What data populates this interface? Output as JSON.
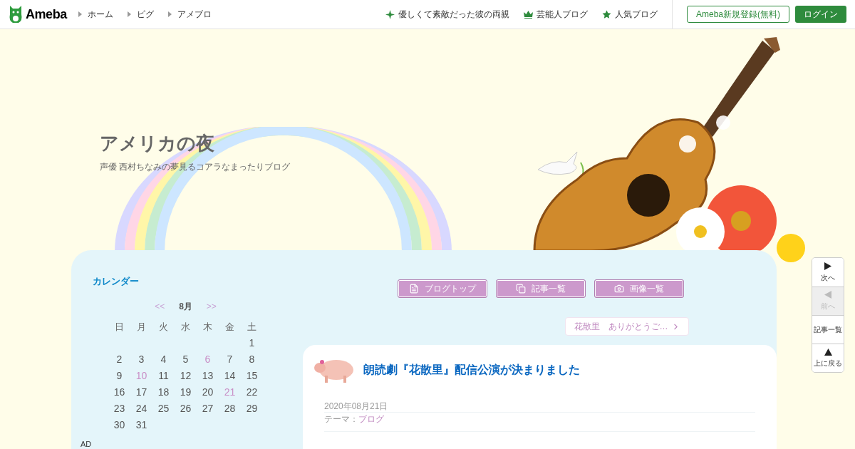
{
  "header": {
    "logo": "Ameba",
    "breadcrumbs": [
      "ホーム",
      "ピグ",
      "アメブロ"
    ],
    "links": [
      {
        "kind": "sparkle",
        "label": "優しくて素敵だった彼の両親"
      },
      {
        "kind": "crown",
        "label": "芸能人ブログ"
      },
      {
        "kind": "star",
        "label": "人気ブログ"
      }
    ],
    "register_button": "Ameba新規登録(無料)",
    "login_button": "ログイン"
  },
  "blog": {
    "title": "アメリカの夜",
    "description": "声優 西村ちなみの夢見るコアラなまったりブログ"
  },
  "calendar": {
    "heading": "カレンダー",
    "prev": "<<",
    "month": "8月",
    "next": ">>",
    "weekdays": [
      "日",
      "月",
      "火",
      "水",
      "木",
      "金",
      "土"
    ],
    "weeks": [
      [
        {
          "day": "1",
          "has_entry": false
        }
      ],
      [
        {
          "day": "2",
          "has_entry": false
        },
        {
          "day": "3",
          "has_entry": false
        },
        {
          "day": "4",
          "has_entry": false
        },
        {
          "day": "5",
          "has_entry": false
        },
        {
          "day": "6",
          "has_entry": true
        },
        {
          "day": "7",
          "has_entry": false
        },
        {
          "day": "8",
          "has_entry": false
        }
      ],
      [
        {
          "day": "9",
          "has_entry": false
        },
        {
          "day": "10",
          "has_entry": true
        },
        {
          "day": "11",
          "has_entry": false
        },
        {
          "day": "12",
          "has_entry": false
        },
        {
          "day": "13",
          "has_entry": false
        },
        {
          "day": "14",
          "has_entry": false
        },
        {
          "day": "15",
          "has_entry": false
        }
      ],
      [
        {
          "day": "16",
          "has_entry": false
        },
        {
          "day": "17",
          "has_entry": false
        },
        {
          "day": "18",
          "has_entry": false
        },
        {
          "day": "19",
          "has_entry": false
        },
        {
          "day": "20",
          "has_entry": false
        },
        {
          "day": "21",
          "has_entry": true
        },
        {
          "day": "22",
          "has_entry": false
        }
      ],
      [
        {
          "day": "23",
          "has_entry": false
        },
        {
          "day": "24",
          "has_entry": false
        },
        {
          "day": "25",
          "has_entry": false
        },
        {
          "day": "26",
          "has_entry": false
        },
        {
          "day": "27",
          "has_entry": false
        },
        {
          "day": "28",
          "has_entry": false
        },
        {
          "day": "29",
          "has_entry": false
        }
      ],
      [
        {
          "day": "30",
          "has_entry": false
        },
        {
          "day": "31",
          "has_entry": false
        }
      ]
    ]
  },
  "ad_label": "AD",
  "blog_menu": [
    {
      "kind": "top",
      "label": "ブログトップ"
    },
    {
      "kind": "list",
      "label": "記事一覧"
    },
    {
      "kind": "images",
      "label": "画像一覧"
    }
  ],
  "next_entry": "花散里　ありがとうご…",
  "article": {
    "title": "朗読劇『花散里』配信公演が決まりました",
    "date": "2020年08月21日",
    "theme_label": "テーマ：",
    "theme": "ブログ"
  },
  "side_nav": [
    {
      "kind": "next",
      "label": "次へ",
      "disabled": false
    },
    {
      "kind": "prev",
      "label": "前へ",
      "disabled": true
    },
    {
      "kind": "list",
      "label": "記事一覧",
      "disabled": false
    },
    {
      "kind": "top",
      "label": "上に戻る",
      "disabled": false
    }
  ]
}
